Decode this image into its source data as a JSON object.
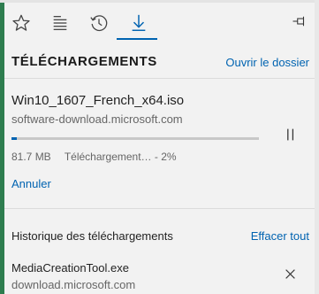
{
  "toolbar": {
    "tabs": [
      {
        "icon": "star-icon"
      },
      {
        "icon": "reading-list-icon"
      },
      {
        "icon": "history-icon"
      },
      {
        "icon": "download-icon",
        "active": true
      }
    ],
    "pin_icon": "pin-icon",
    "accent": "#0063b1"
  },
  "header": {
    "title": "TÉLÉCHARGEMENTS",
    "open_folder": "Ouvrir le dossier"
  },
  "current_download": {
    "filename": "Win10_1607_French_x64.iso",
    "source": "software-download.microsoft.com",
    "progress_percent": 2,
    "size": "81.7 MB",
    "status": "Téléchargement… - 2%",
    "cancel": "Annuler"
  },
  "history": {
    "title": "Historique des téléchargements",
    "clear_all": "Effacer tout",
    "items": [
      {
        "filename": "MediaCreationTool.exe",
        "source": "download.microsoft.com"
      }
    ]
  }
}
